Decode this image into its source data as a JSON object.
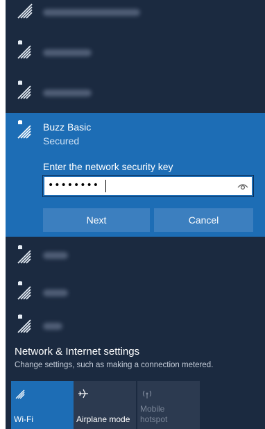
{
  "networks": {
    "expanded": {
      "name": "Buzz Basic",
      "status": "Secured",
      "key_prompt": "Enter the network security key",
      "password_masked": "••••••••",
      "next_label": "Next",
      "cancel_label": "Cancel"
    }
  },
  "settings": {
    "title": "Network & Internet settings",
    "subtitle": "Change settings, such as making a connection metered."
  },
  "quick_actions": [
    {
      "label": "Wi-Fi",
      "state": "on",
      "icon": "wifi-icon"
    },
    {
      "label": "Airplane mode",
      "state": "off",
      "icon": "airplane-icon"
    },
    {
      "label": "Mobile\nhotspot",
      "state": "disabled",
      "icon": "hotspot-icon"
    }
  ],
  "colors": {
    "panel_bg": "#1b2a40",
    "accent": "#1d6db5",
    "button_bg": "#3c7fbf",
    "tile_off": "#2c3a50"
  }
}
